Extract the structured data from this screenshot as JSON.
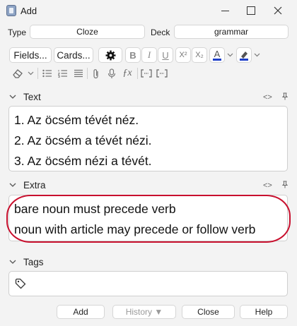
{
  "window": {
    "title": "Add"
  },
  "header": {
    "type_label": "Type",
    "type_value": "Cloze",
    "deck_label": "Deck",
    "deck_value": "grammar"
  },
  "toolbar": {
    "fields_label": "Fields...",
    "cards_label": "Cards...",
    "bold": "B",
    "italic": "I",
    "underline": "U",
    "superscript": "X²",
    "subscript": "X₂",
    "text_color_letter": "A",
    "text_color": "#1e40c9",
    "highlight_color": "#1e40c9"
  },
  "sections": {
    "text_label": "Text",
    "extra_label": "Extra",
    "tags_label": "Tags"
  },
  "text_field": {
    "lines": [
      "1. Az öcsém tévét néz.",
      "2. Az öcsém a tévét nézi.",
      "3. Az öcsém nézi a tévét."
    ]
  },
  "extra_field": {
    "lines": [
      "bare noun must precede verb",
      "noun with article may precede or follow verb"
    ]
  },
  "buttons": {
    "add": "Add",
    "history": "History ▼",
    "close": "Close",
    "help": "Help"
  },
  "colors": {
    "annotation_ellipse": "#c8102e"
  }
}
